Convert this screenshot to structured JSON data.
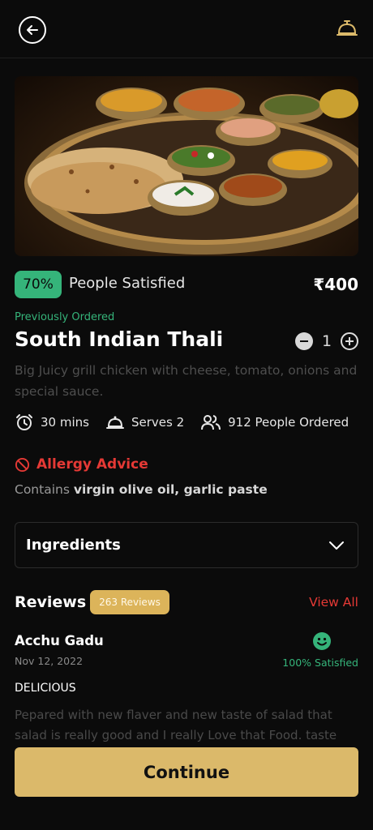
{
  "header": {
    "back_icon": "arrow-left-circle-icon",
    "bell_icon": "service-bell-icon"
  },
  "hero": {
    "image": "south-indian-thali-photo"
  },
  "satisfaction": {
    "percent": "70%",
    "label": "People Satisfied"
  },
  "price": "₹400",
  "dish": {
    "previously_ordered": "Previously Ordered",
    "title": "South Indian Thali",
    "quantity": "1",
    "description": "Big Juicy grill chicken with cheese, tomato, onions and special sauce."
  },
  "meta": {
    "time": "30 mins",
    "serves": "Serves 2",
    "ordered": "912 People Ordered"
  },
  "allergy": {
    "title": "Allergy Advice",
    "prefix": "Contains ",
    "items": "virgin olive oil, garlic paste"
  },
  "ingredients": {
    "label": "Ingredients"
  },
  "reviews": {
    "title": "Reviews",
    "count": "263 Reviews",
    "view_all": "View All",
    "items": [
      {
        "name": "Acchu Gadu",
        "date": "Nov 12, 2022",
        "satisfied": "100% Satisfied",
        "headline": "DELICIOUS",
        "body": "Pepared with new flaver and new taste of salad that salad is really good and I really Love that Food. taste"
      }
    ]
  },
  "cta": {
    "continue": "Continue"
  },
  "colors": {
    "accent_green": "#35b47a",
    "accent_gold": "#dbb96a",
    "accent_red": "#e53935",
    "background": "#0b0b0b"
  }
}
